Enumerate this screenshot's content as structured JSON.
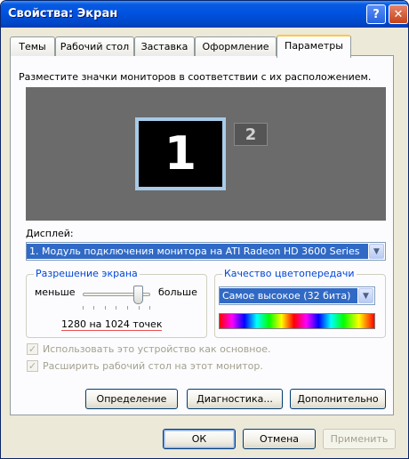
{
  "window": {
    "title": "Свойства: Экран",
    "help_label": "?",
    "close_label": "✕"
  },
  "tabs": [
    {
      "label": "Темы"
    },
    {
      "label": "Рабочий стол"
    },
    {
      "label": "Заставка"
    },
    {
      "label": "Оформление"
    },
    {
      "label": "Параметры",
      "active": true
    }
  ],
  "settings": {
    "instruction": "Разместите значки мониторов в соответствии с их расположением.",
    "monitors": [
      {
        "number": "1",
        "selected": true
      },
      {
        "number": "2",
        "selected": false
      }
    ],
    "display_label": "Дисплей:",
    "display_value": "1. Модуль подключения монитора на ATI Radeon HD 3600 Series",
    "resolution": {
      "title": "Разрешение экрана",
      "less": "меньше",
      "more": "больше",
      "value": "1280 на 1024 точек",
      "slider_fraction": 0.85
    },
    "color": {
      "title": "Качество цветопередачи",
      "value": "Самое высокое (32 бита)"
    },
    "primary_checkbox": {
      "label": "Использовать это устройство как основное.",
      "checked": true,
      "enabled": false
    },
    "extend_checkbox": {
      "label": "Расширить рабочий стол на этот монитор.",
      "checked": true,
      "enabled": false
    },
    "buttons": {
      "identify": "Определение",
      "troubleshoot": "Диагностика...",
      "advanced": "Дополнительно"
    }
  },
  "footer": {
    "ok": "ОК",
    "cancel": "Отмена",
    "apply": "Применить"
  },
  "colors": {
    "title_bar": "#0054e3",
    "selection": "#316ac5",
    "face": "#ece9d8"
  }
}
